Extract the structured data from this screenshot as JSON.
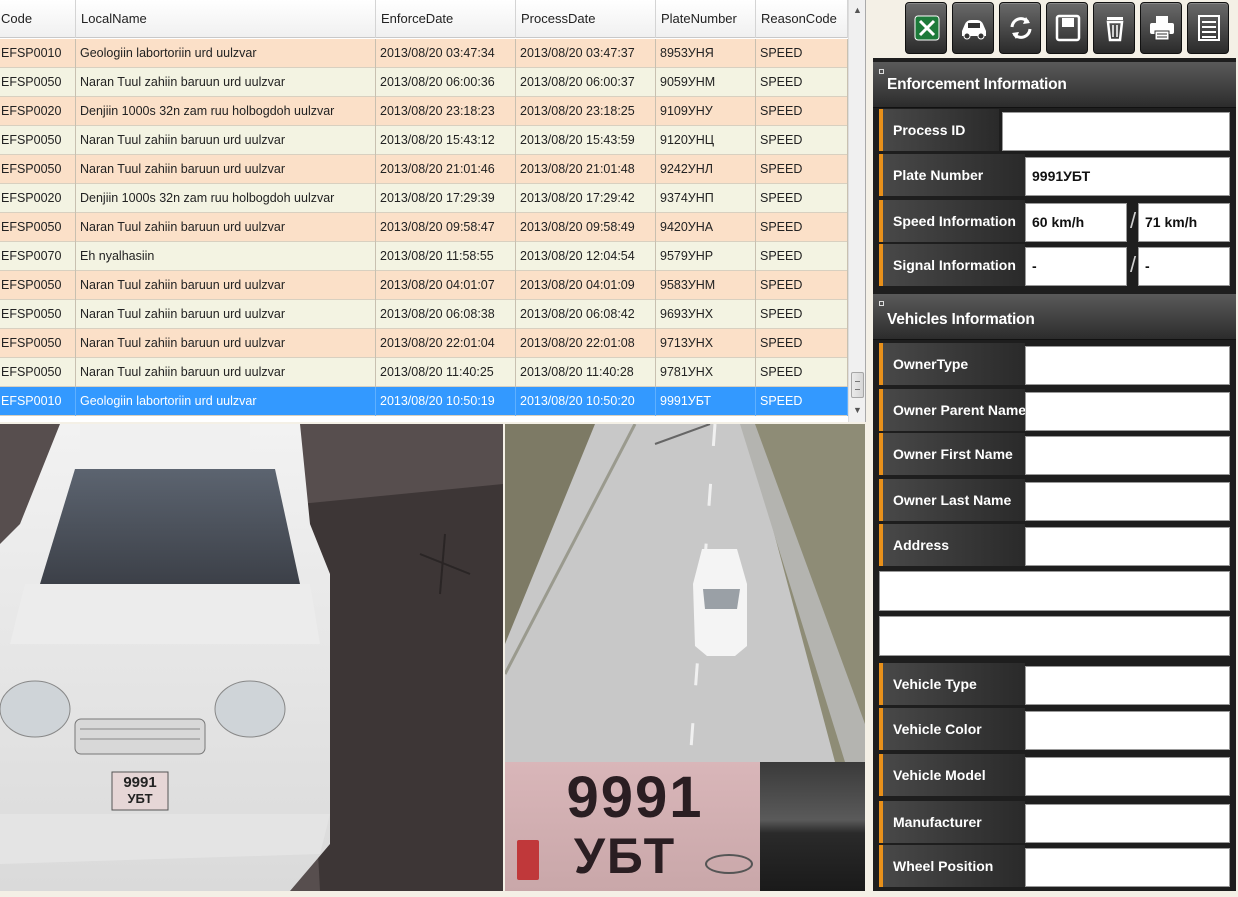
{
  "grid": {
    "columns": [
      "Code",
      "LocalName",
      "EnforceDate",
      "ProcessDate",
      "PlateNumber",
      "ReasonCode"
    ],
    "rows": [
      {
        "code": "EFSP0010",
        "name": "Geologiin labortoriin urd uulzvar",
        "enforce": "2013/08/20 03:47:34",
        "process": "2013/08/20 03:47:37",
        "plate": "8953УНЯ",
        "reason": "SPEED"
      },
      {
        "code": "EFSP0050",
        "name": "Naran Tuul zahiin baruun urd uulzvar",
        "enforce": "2013/08/20 06:00:36",
        "process": "2013/08/20 06:00:37",
        "plate": "9059УНМ",
        "reason": "SPEED"
      },
      {
        "code": "EFSP0020",
        "name": "Denjiin 1000s 32n zam ruu holbogdoh uulzvar",
        "enforce": "2013/08/20 23:18:23",
        "process": "2013/08/20 23:18:25",
        "plate": "9109УНУ",
        "reason": "SPEED"
      },
      {
        "code": "EFSP0050",
        "name": "Naran Tuul zahiin baruun urd uulzvar",
        "enforce": "2013/08/20 15:43:12",
        "process": "2013/08/20 15:43:59",
        "plate": "9120УНЦ",
        "reason": "SPEED"
      },
      {
        "code": "EFSP0050",
        "name": "Naran Tuul zahiin baruun urd uulzvar",
        "enforce": "2013/08/20 21:01:46",
        "process": "2013/08/20 21:01:48",
        "plate": "9242УНЛ",
        "reason": "SPEED"
      },
      {
        "code": "EFSP0020",
        "name": "Denjiin 1000s 32n zam ruu holbogdoh uulzvar",
        "enforce": "2013/08/20 17:29:39",
        "process": "2013/08/20 17:29:42",
        "plate": "9374УНП",
        "reason": "SPEED"
      },
      {
        "code": "EFSP0050",
        "name": "Naran Tuul zahiin baruun urd uulzvar",
        "enforce": "2013/08/20 09:58:47",
        "process": "2013/08/20 09:58:49",
        "plate": "9420УНА",
        "reason": "SPEED"
      },
      {
        "code": "EFSP0070",
        "name": "Eh nyalhasiin",
        "enforce": "2013/08/20 11:58:55",
        "process": "2013/08/20 12:04:54",
        "plate": "9579УНР",
        "reason": "SPEED"
      },
      {
        "code": "EFSP0050",
        "name": "Naran Tuul zahiin baruun urd uulzvar",
        "enforce": "2013/08/20 04:01:07",
        "process": "2013/08/20 04:01:09",
        "plate": "9583УНМ",
        "reason": "SPEED"
      },
      {
        "code": "EFSP0050",
        "name": "Naran Tuul zahiin baruun urd uulzvar",
        "enforce": "2013/08/20 06:08:38",
        "process": "2013/08/20 06:08:42",
        "plate": "9693УНХ",
        "reason": "SPEED"
      },
      {
        "code": "EFSP0050",
        "name": "Naran Tuul zahiin baruun urd uulzvar",
        "enforce": "2013/08/20 22:01:04",
        "process": "2013/08/20 22:01:08",
        "plate": "9713УНХ",
        "reason": "SPEED"
      },
      {
        "code": "EFSP0050",
        "name": "Naran Tuul zahiin baruun urd uulzvar",
        "enforce": "2013/08/20 11:40:25",
        "process": "2013/08/20 11:40:28",
        "plate": "9781УНХ",
        "reason": "SPEED"
      },
      {
        "code": "EFSP0010",
        "name": "Geologiin labortoriin urd uulzvar",
        "enforce": "2013/08/20 10:50:19",
        "process": "2013/08/20 10:50:20",
        "plate": "9991УБТ",
        "reason": "SPEED",
        "selected": true
      }
    ]
  },
  "images": {
    "car_plate_top": "9991",
    "car_plate_bottom": "УБТ",
    "zoom_plate_top": "9991",
    "zoom_plate_bottom": "УБТ"
  },
  "toolbar": {
    "buttons": [
      "excel-export-icon",
      "car-icon",
      "refresh-icon",
      "save-icon",
      "trash-icon",
      "printer-icon",
      "list-icon"
    ]
  },
  "enforcement": {
    "title": "Enforcement Information",
    "process_id_label": "Process ID",
    "process_id_value": "",
    "plate_label": "Plate Number",
    "plate_value": "9991УБТ",
    "speed_label": "Speed Information",
    "speed_value_1": "60 km/h",
    "speed_sep": "/",
    "speed_value_2": "71 km/h",
    "signal_label": "Signal Information",
    "signal_value_1": "-",
    "signal_sep": "/",
    "signal_value_2": "-"
  },
  "vehicles": {
    "title": "Vehicles Information",
    "owner_type_label": "OwnerType",
    "owner_type_value": "",
    "owner_parent_label": "Owner Parent Name",
    "owner_parent_value": "",
    "owner_first_label": "Owner First Name",
    "owner_first_value": "",
    "owner_last_label": "Owner Last Name",
    "owner_last_value": "",
    "address_label": "Address",
    "address_value": "",
    "address_line2": "",
    "address_line3": "",
    "vehicle_type_label": "Vehicle Type",
    "vehicle_type_value": "",
    "vehicle_color_label": "Vehicle Color",
    "vehicle_color_value": "",
    "vehicle_model_label": "Vehicle Model",
    "vehicle_model_value": "",
    "manufacturer_label": "Manufacturer",
    "manufacturer_value": "",
    "wheel_label": "Wheel Position",
    "wheel_value": ""
  }
}
